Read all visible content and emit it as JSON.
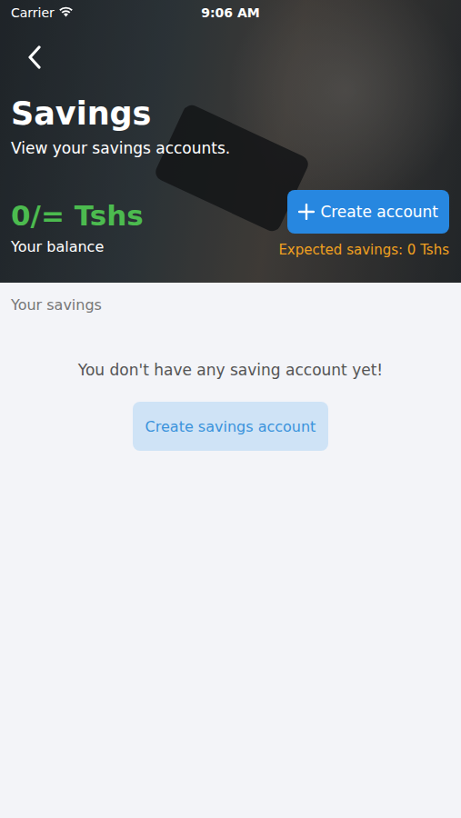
{
  "status_bar": {
    "carrier": "Carrier",
    "time": "9:06 AM"
  },
  "header": {
    "title": "Savings",
    "subtitle": "View your savings accounts.",
    "balance": {
      "amount": "0/= Tshs",
      "label": "Your balance"
    },
    "create_button": "Create account",
    "expected": "Expected savings: 0 Tshs"
  },
  "section": {
    "title": "Your savings",
    "empty_message": "You don't have any saving account yet!",
    "button": "Create savings account"
  }
}
